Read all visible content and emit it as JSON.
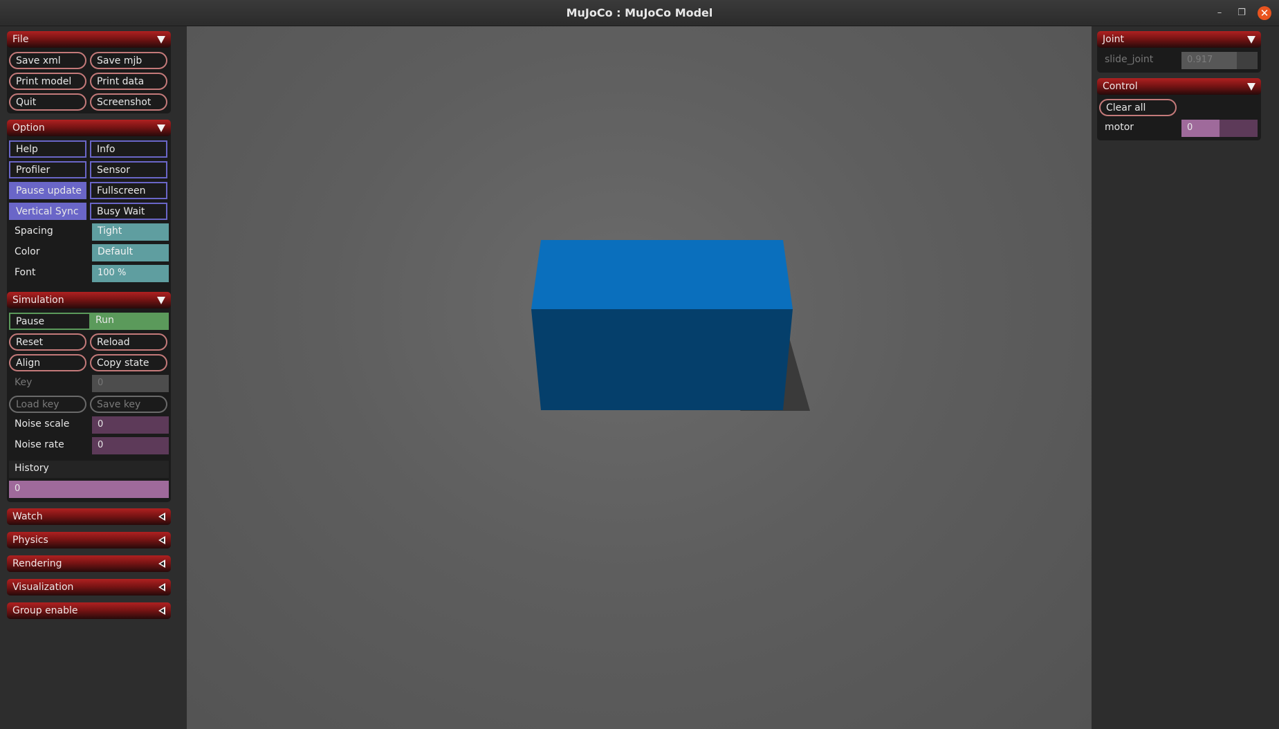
{
  "window": {
    "title": "MuJoCo : MuJoCo Model"
  },
  "left": {
    "file": {
      "title": "File",
      "buttons": [
        "Save xml",
        "Save mjb",
        "Print model",
        "Print data",
        "Quit",
        "Screenshot"
      ]
    },
    "option": {
      "title": "Option",
      "checks": [
        {
          "label": "Help",
          "on": false
        },
        {
          "label": "Info",
          "on": false
        },
        {
          "label": "Profiler",
          "on": false
        },
        {
          "label": "Sensor",
          "on": false
        },
        {
          "label": "Pause update",
          "on": true
        },
        {
          "label": "Fullscreen",
          "on": false
        },
        {
          "label": "Vertical Sync",
          "on": true
        },
        {
          "label": "Busy Wait",
          "on": false
        }
      ],
      "spacing_label": "Spacing",
      "spacing_value": "Tight",
      "color_label": "Color",
      "color_value": "Default",
      "font_label": "Font",
      "font_value": "100 %"
    },
    "simulation": {
      "title": "Simulation",
      "pause_label": "Pause",
      "run_label": "Run",
      "reset": "Reset",
      "reload": "Reload",
      "align": "Align",
      "copy_state": "Copy state",
      "key_label": "Key",
      "key_value": "0",
      "load_key": "Load key",
      "save_key": "Save key",
      "noise_scale_label": "Noise scale",
      "noise_scale_value": "0",
      "noise_rate_label": "Noise rate",
      "noise_rate_value": "0",
      "history_label": "History",
      "history_value": "0"
    },
    "collapsed": [
      "Watch",
      "Physics",
      "Rendering",
      "Visualization",
      "Group enable"
    ]
  },
  "right": {
    "joint": {
      "title": "Joint",
      "slide_label": "slide_joint",
      "slide_value": "0.917",
      "slide_fraction": 0.73
    },
    "control": {
      "title": "Control",
      "clear_all": "Clear all",
      "motor_label": "motor",
      "motor_value": "0",
      "motor_fraction": 0.5
    }
  },
  "scene": {
    "box_color": "#0a6fbd"
  }
}
